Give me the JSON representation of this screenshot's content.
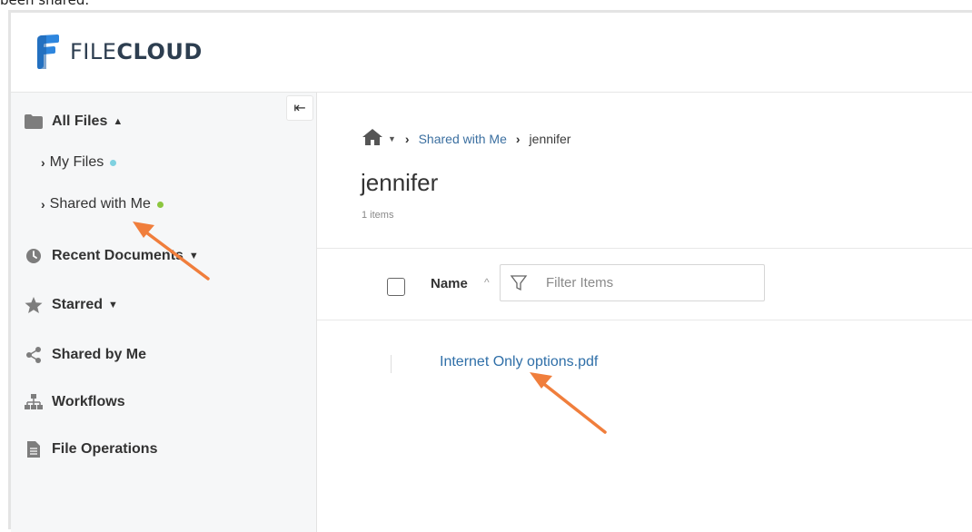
{
  "caption": "been shared.",
  "brand": {
    "name_light": "FILE",
    "name_bold": "CLOUD"
  },
  "sidebar": {
    "collapse_icon": "collapse-left-icon",
    "items": [
      {
        "label": "All Files",
        "icon": "folder-icon"
      },
      {
        "label": "My Files",
        "dot_color": "#7fd1e0"
      },
      {
        "label": "Shared with Me",
        "dot_color": "#8cc63f"
      },
      {
        "label": "Recent Documents",
        "icon": "clock-icon"
      },
      {
        "label": "Starred",
        "icon": "star-icon"
      },
      {
        "label": "Shared by Me",
        "icon": "share-icon"
      },
      {
        "label": "Workflows",
        "icon": "workflow-icon"
      },
      {
        "label": "File Operations",
        "icon": "file-icon"
      }
    ]
  },
  "breadcrumb": {
    "items": [
      "Shared with Me",
      "jennifer"
    ]
  },
  "page": {
    "title": "jennifer",
    "count": "1 items"
  },
  "table": {
    "column_name": "Name",
    "filter_placeholder": "Filter Items"
  },
  "files": [
    {
      "name": "Internet Only options.pdf"
    }
  ],
  "colors": {
    "accent": "#2f6fa8",
    "annotation": "#f07e3c"
  }
}
